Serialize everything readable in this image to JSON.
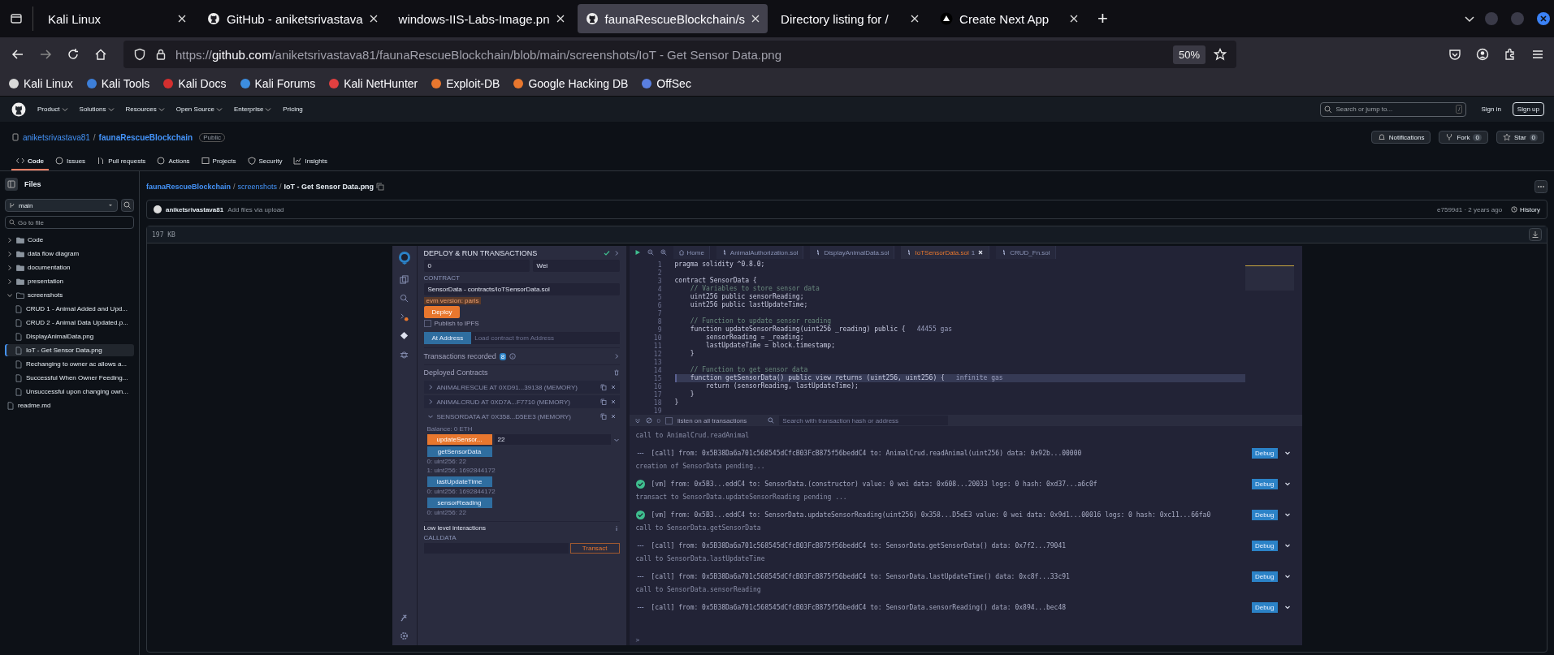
{
  "browser": {
    "tabs": [
      {
        "label": "Kali Linux",
        "kind": "plain",
        "selected": false
      },
      {
        "label": "GitHub - aniketsrivastava",
        "kind": "github",
        "selected": false
      },
      {
        "label": "windows-IIS-Labs-Image.pn",
        "kind": "plain",
        "selected": false
      },
      {
        "label": "faunaRescueBlockchain/s",
        "kind": "github",
        "selected": true
      },
      {
        "label": "Directory listing for /",
        "kind": "plain",
        "selected": false
      },
      {
        "label": "Create Next App",
        "kind": "next",
        "selected": false
      }
    ],
    "new_tab": "+",
    "address": {
      "scheme": "https://",
      "host": "github.com",
      "path": "/aniketsrivastava81/faunaRescueBlockchain/blob/main/screenshots/IoT - Get Sensor Data.png"
    },
    "zoom": "50%",
    "bookmarks": [
      {
        "label": "Kali Linux",
        "color": "#d8d8d8"
      },
      {
        "label": "Kali Tools",
        "color": "#3d7fd9"
      },
      {
        "label": "Kali Docs",
        "color": "#d32f2f"
      },
      {
        "label": "Kali Forums",
        "color": "#3d8ee0"
      },
      {
        "label": "Kali NetHunter",
        "color": "#e04040"
      },
      {
        "label": "Exploit-DB",
        "color": "#e8772e"
      },
      {
        "label": "Google Hacking DB",
        "color": "#e8772e"
      },
      {
        "label": "OffSec",
        "color": "#5a7fe0"
      }
    ]
  },
  "github": {
    "nav": [
      {
        "label": "Product",
        "dropdown": true
      },
      {
        "label": "Solutions",
        "dropdown": true
      },
      {
        "label": "Resources",
        "dropdown": true
      },
      {
        "label": "Open Source",
        "dropdown": true
      },
      {
        "label": "Enterprise",
        "dropdown": true
      },
      {
        "label": "Pricing",
        "dropdown": false
      }
    ],
    "search": {
      "placeholder": "Search or jump to...",
      "key": "/"
    },
    "sign_in": "Sign in",
    "sign_up": "Sign up",
    "repo": {
      "owner": "aniketsrivastava81",
      "separator": "/",
      "name": "faunaRescueBlockchain",
      "visibility": "Public",
      "actions": [
        {
          "kind": "bell",
          "label": "Notifications"
        },
        {
          "kind": "fork",
          "label": "Fork",
          "count": "0"
        },
        {
          "kind": "star",
          "label": "Star",
          "count": "0"
        }
      ]
    },
    "tabs": [
      {
        "label": "Code",
        "kind": "code",
        "selected": true
      },
      {
        "label": "Issues",
        "kind": "issue",
        "selected": false
      },
      {
        "label": "Pull requests",
        "kind": "pr",
        "selected": false
      },
      {
        "label": "Actions",
        "kind": "play",
        "selected": false
      },
      {
        "label": "Projects",
        "kind": "table",
        "selected": false
      },
      {
        "label": "Security",
        "kind": "shield",
        "selected": false
      },
      {
        "label": "Insights",
        "kind": "graph",
        "selected": false
      }
    ],
    "sidebar": {
      "title": "Files",
      "branch": "main",
      "filter_placeholder": "Go to file",
      "tree": [
        {
          "name": "Code",
          "kind": "folder",
          "expanded": false,
          "selected": false
        },
        {
          "name": "data flow diagram",
          "kind": "folder",
          "expanded": false,
          "selected": false
        },
        {
          "name": "documentation",
          "kind": "folder",
          "expanded": false,
          "selected": false
        },
        {
          "name": "presentation",
          "kind": "folder",
          "expanded": false,
          "selected": false
        },
        {
          "name": "screenshots",
          "kind": "folder",
          "expanded": true,
          "selected": false,
          "children": [
            {
              "name": "CRUD 1 - Animal Added and Upd...",
              "kind": "file",
              "selected": false
            },
            {
              "name": "CRUD 2 - Animal Data Updated.p...",
              "kind": "file",
              "selected": false
            },
            {
              "name": "DisplayAnimalData.png",
              "kind": "file",
              "selected": false
            },
            {
              "name": "IoT - Get Sensor Data.png",
              "kind": "file",
              "selected": true
            },
            {
              "name": "Rechanging to owner ac allows a...",
              "kind": "file",
              "selected": false
            },
            {
              "name": "Successful When Owner Feeding...",
              "kind": "file",
              "selected": false
            },
            {
              "name": "Unsuccessful upon changing own...",
              "kind": "file",
              "selected": false
            }
          ]
        },
        {
          "name": "readme.md",
          "kind": "file",
          "selected": false
        }
      ]
    },
    "breadcrumb": [
      {
        "label": "faunaRescueBlockchain",
        "kind": "link"
      },
      {
        "label": "screenshots",
        "kind": "link"
      },
      {
        "label": "IoT - Get Sensor Data.png",
        "kind": "current"
      }
    ],
    "breadcrumb_separator": "/",
    "commit": {
      "author": "aniketsrivastava81",
      "message": "Add files via upload",
      "meta": "e7599d1 · 2 years ago",
      "history": "History"
    },
    "file_size": "197 KB"
  },
  "remix": {
    "deploy": {
      "title": "DEPLOY & RUN TRANSACTIONS",
      "value": "0",
      "unit": "Wei",
      "contract_label": "CONTRACT",
      "contract": "SensorData - contracts/IoTSensorData.sol",
      "evm_tag": "evm version: paris",
      "deploy_button": "Deploy",
      "publish": {
        "label": "Publish to IPFS",
        "checked": false
      },
      "at_address_button": "At Address",
      "at_address_placeholder": "Load contract from Address",
      "recorded": {
        "label": "Transactions recorded",
        "count": "8"
      },
      "deployed_title": "Deployed Contracts",
      "contracts": [
        {
          "label": "ANIMALRESCUE AT 0XD91...39138 (MEMORY)",
          "expanded": false
        },
        {
          "label": "ANIMALCRUD AT 0XD7A...F7710 (MEMORY)",
          "expanded": false
        },
        {
          "label": "SENSORDATA AT 0X358...D5EE3 (MEMORY)",
          "expanded": true,
          "balance": "Balance: 0 ETH",
          "functions": [
            {
              "name": "updateSensor...",
              "kind": "transact",
              "input": "22"
            },
            {
              "name": "getSensorData",
              "kind": "call",
              "outputs": [
                "0: uint256: 22",
                "1: uint256: 1692844172"
              ]
            },
            {
              "name": "lastUpdateTime",
              "kind": "call",
              "outputs": [
                "0: uint256: 1692844172"
              ]
            },
            {
              "name": "sensorReading",
              "kind": "call",
              "outputs": [
                "0: uint256: 22"
              ]
            }
          ]
        }
      ],
      "low_level": "Low level interactions",
      "calldata": "CALLDATA",
      "transact_button": "Transact"
    },
    "editor": {
      "tabs": [
        {
          "label": "Home",
          "kind": "home",
          "selected": false
        },
        {
          "label": "AnimalAuthorization.sol",
          "kind": "sol",
          "selected": false
        },
        {
          "label": "DisplayAnimalData.sol",
          "kind": "sol",
          "selected": false
        },
        {
          "label": "IoTSensorData.sol",
          "kind": "sol",
          "selected": true,
          "badge": "1"
        },
        {
          "label": "CRUD_Fn.sol",
          "kind": "sol",
          "selected": false
        }
      ],
      "lines": [
        {
          "n": "1",
          "text": "pragma solidity ^0.8.0;",
          "kind": "code",
          "current": false
        },
        {
          "n": "2"
        },
        {
          "n": "3",
          "text": "contract SensorData {",
          "kind": "code",
          "current": false
        },
        {
          "n": "4",
          "text": "    // Variables to store sensor data",
          "kind": "comment",
          "current": false
        },
        {
          "n": "5",
          "text": "    uint256 public sensorReading;",
          "kind": "code",
          "current": false
        },
        {
          "n": "6",
          "text": "    uint256 public lastUpdateTime;",
          "kind": "code",
          "current": false
        },
        {
          "n": "7"
        },
        {
          "n": "8",
          "text": "    // Function to update sensor reading",
          "kind": "comment",
          "current": false
        },
        {
          "n": "9",
          "text": "    function updateSensorReading(uint256 _reading) public {",
          "kind": "code",
          "current": false,
          "gas": "44455 gas"
        },
        {
          "n": "10",
          "text": "        sensorReading = _reading;",
          "kind": "code",
          "current": false
        },
        {
          "n": "11",
          "text": "        lastUpdateTime = block.timestamp;",
          "kind": "code",
          "current": false
        },
        {
          "n": "12",
          "text": "    }",
          "kind": "code",
          "current": false
        },
        {
          "n": "13"
        },
        {
          "n": "14",
          "text": "    // Function to get sensor data",
          "kind": "comment",
          "current": false
        },
        {
          "n": "15",
          "text": "    function getSensorData() public view returns (uint256, uint256) {",
          "kind": "code",
          "current": true,
          "gas": "infinite gas"
        },
        {
          "n": "16",
          "text": "        return (sensorReading, lastUpdateTime);",
          "kind": "code",
          "current": false
        },
        {
          "n": "17",
          "text": "    }",
          "kind": "code",
          "current": false
        },
        {
          "n": "18",
          "text": "}",
          "kind": "code",
          "current": false
        },
        {
          "n": "19"
        }
      ]
    },
    "terminal": {
      "count": "0",
      "listen": {
        "label": "listen on all transactions",
        "checked": false
      },
      "search_placeholder": "Search with transaction hash or address",
      "log": [
        {
          "kind": "note",
          "text": "call to AnimalCrud.readAnimal"
        },
        {
          "kind": "call",
          "text": "[call]  from: 0x5B38Da6a701c568545dCfcB03FcB875f56beddC4 to: AnimalCrud.readAnimal(uint256) data: 0x92b...00000",
          "debug": "Debug"
        },
        {
          "kind": "note",
          "text": "creation of SensorData pending..."
        },
        {
          "kind": "vm",
          "text": "[vm]  from: 0x5B3...eddC4 to: SensorData.(constructor) value: 0 wei data: 0x608...20033 logs: 0 hash: 0xd37...a6c0f",
          "debug": "Debug"
        },
        {
          "kind": "note",
          "text": "transact to SensorData.updateSensorReading pending ..."
        },
        {
          "kind": "vm",
          "text": "[vm]  from: 0x5B3...eddC4 to: SensorData.updateSensorReading(uint256) 0x358...D5eE3 value: 0 wei data: 0x9d1...00016 logs: 0 hash: 0xc11...66fa0",
          "debug": "Debug"
        },
        {
          "kind": "note",
          "text": "call to SensorData.getSensorData"
        },
        {
          "kind": "call",
          "text": "[call]  from: 0x5B38Da6a701c568545dCfcB03FcB875f56beddC4 to: SensorData.getSensorData() data: 0x7f2...79041",
          "debug": "Debug"
        },
        {
          "kind": "note",
          "text": "call to SensorData.lastUpdateTime"
        },
        {
          "kind": "call",
          "text": "[call]  from: 0x5B38Da6a701c568545dCfcB03FcB875f56beddC4 to: SensorData.lastUpdateTime() data: 0xc8f...33c91",
          "debug": "Debug"
        },
        {
          "kind": "note",
          "text": "call to SensorData.sensorReading"
        },
        {
          "kind": "call",
          "text": "[call]  from: 0x5B38Da6a701c568545dCfcB03FcB875f56beddC4 to: SensorData.sensorReading() data: 0x894...bec48",
          "debug": "Debug"
        }
      ],
      "prompt": ">"
    }
  }
}
